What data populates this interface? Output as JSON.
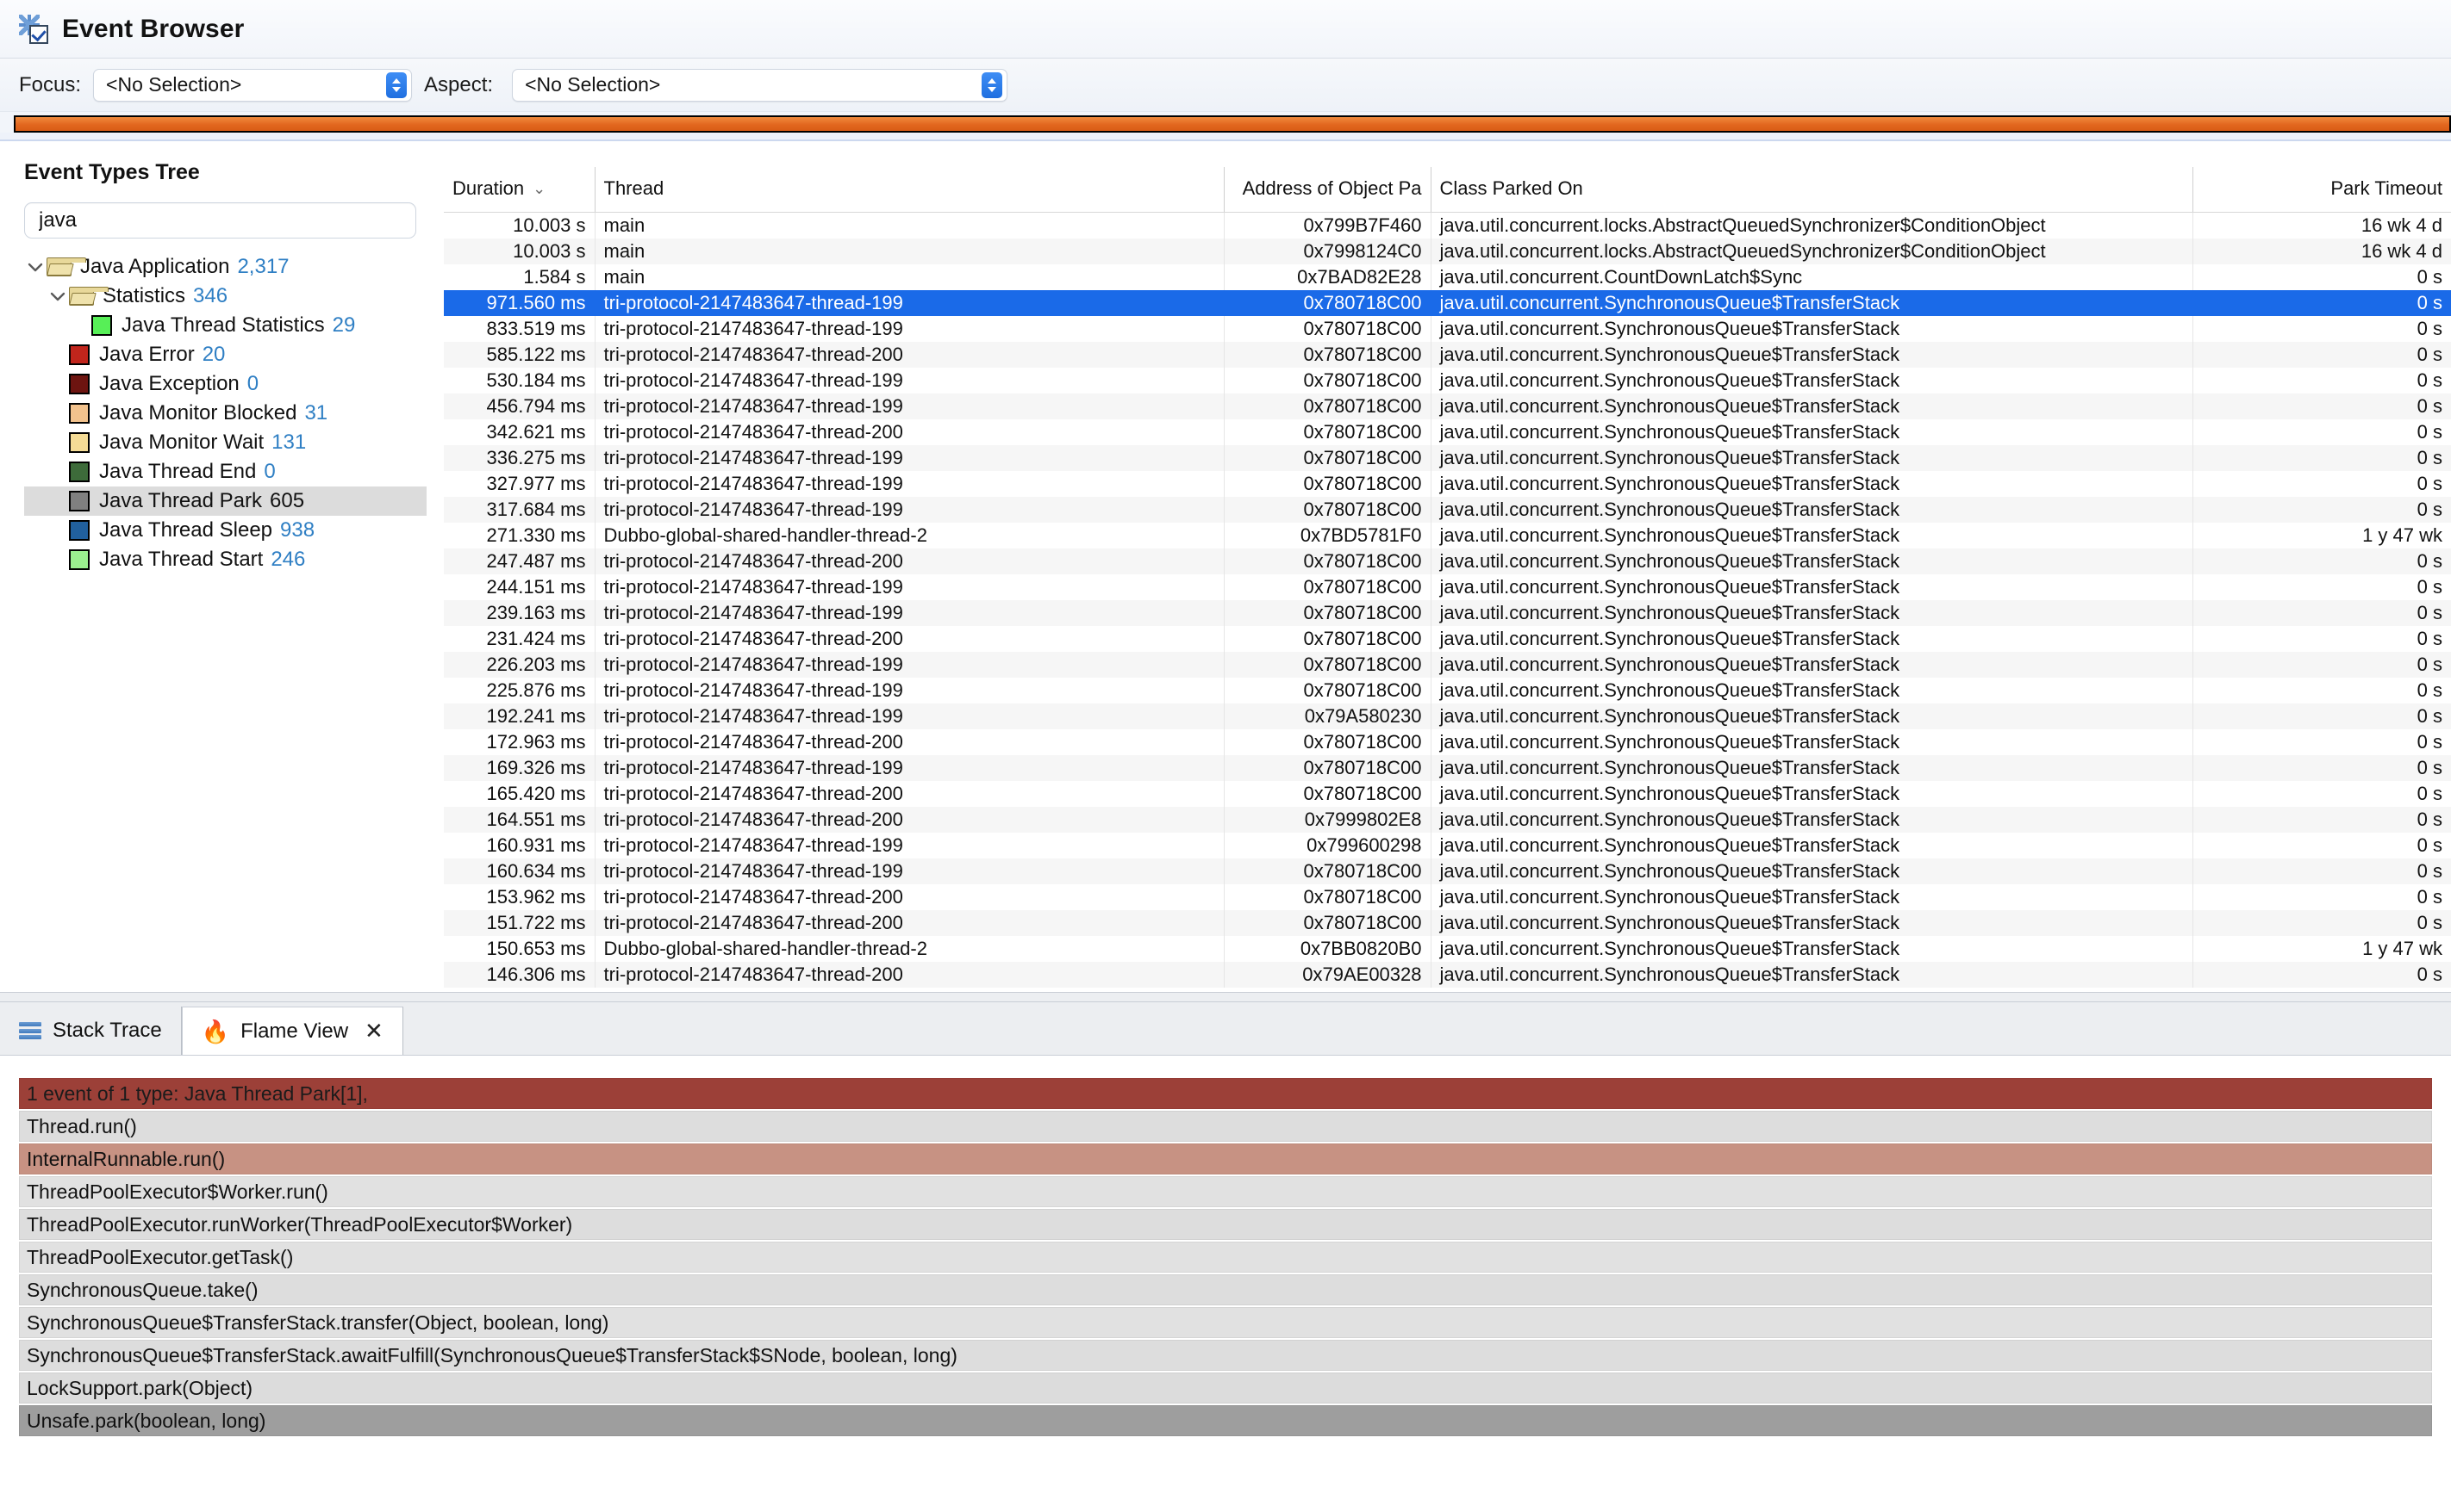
{
  "window": {
    "title": "Event Browser",
    "icon": "event-browser-icon"
  },
  "toolbar": {
    "focus_label": "Focus:",
    "focus_value": "<No Selection>",
    "aspect_label": "Aspect:",
    "aspect_value": "<No Selection>",
    "ruler_color": "#e2671f"
  },
  "tree": {
    "title": "Event Types Tree",
    "filter_value": "java",
    "filter_placeholder": "",
    "items": [
      {
        "label": "Java Application",
        "count": "2,317",
        "indent": 0,
        "kind": "folder",
        "expanded": true,
        "selected": false
      },
      {
        "label": "Statistics",
        "count": "346",
        "indent": 1,
        "kind": "folder",
        "expanded": true,
        "selected": false
      },
      {
        "label": "Java Thread Statistics",
        "count": "29",
        "indent": 3,
        "kind": "swatch",
        "color": "#57ef57",
        "selected": false
      },
      {
        "label": "Java Error",
        "count": "20",
        "indent": 2,
        "kind": "swatch",
        "color": "#c0251c",
        "selected": false
      },
      {
        "label": "Java Exception",
        "count": "0",
        "indent": 2,
        "kind": "swatch",
        "color": "#6d1410",
        "selected": false
      },
      {
        "label": "Java Monitor Blocked",
        "count": "31",
        "indent": 2,
        "kind": "swatch",
        "color": "#f2c28d",
        "selected": false
      },
      {
        "label": "Java Monitor Wait",
        "count": "131",
        "indent": 2,
        "kind": "swatch",
        "color": "#f5dc96",
        "selected": false
      },
      {
        "label": "Java Thread End",
        "count": "0",
        "indent": 2,
        "kind": "swatch",
        "color": "#3d6b3a",
        "selected": false
      },
      {
        "label": "Java Thread Park",
        "count": "605",
        "indent": 2,
        "kind": "swatch",
        "color": "#808080",
        "selected": true
      },
      {
        "label": "Java Thread Sleep",
        "count": "938",
        "indent": 2,
        "kind": "swatch",
        "color": "#21609e",
        "selected": false
      },
      {
        "label": "Java Thread Start",
        "count": "246",
        "indent": 2,
        "kind": "swatch",
        "color": "#9bef8f",
        "selected": false
      }
    ]
  },
  "table": {
    "columns": [
      {
        "key": "duration",
        "label": "Duration",
        "align": "right",
        "sorted": true,
        "sort_glyph": "⌄"
      },
      {
        "key": "thread",
        "label": "Thread",
        "align": "left"
      },
      {
        "key": "address",
        "label": "Address of Object Pa",
        "align": "right"
      },
      {
        "key": "class",
        "label": "Class Parked On",
        "align": "left"
      },
      {
        "key": "timeout",
        "label": "Park Timeout",
        "align": "right"
      }
    ],
    "selected_row_index": 3,
    "rows": [
      {
        "duration": "10.003 s",
        "thread": "main",
        "address": "0x799B7F460",
        "class": "java.util.concurrent.locks.AbstractQueuedSynchronizer$ConditionObject",
        "timeout": "16 wk 4 d"
      },
      {
        "duration": "10.003 s",
        "thread": "main",
        "address": "0x7998124C0",
        "class": "java.util.concurrent.locks.AbstractQueuedSynchronizer$ConditionObject",
        "timeout": "16 wk 4 d"
      },
      {
        "duration": "1.584 s",
        "thread": "main",
        "address": "0x7BAD82E28",
        "class": "java.util.concurrent.CountDownLatch$Sync",
        "timeout": "0 s"
      },
      {
        "duration": "971.560 ms",
        "thread": "tri-protocol-2147483647-thread-199",
        "address": "0x780718C00",
        "class": "java.util.concurrent.SynchronousQueue$TransferStack",
        "timeout": "0 s"
      },
      {
        "duration": "833.519 ms",
        "thread": "tri-protocol-2147483647-thread-199",
        "address": "0x780718C00",
        "class": "java.util.concurrent.SynchronousQueue$TransferStack",
        "timeout": "0 s"
      },
      {
        "duration": "585.122 ms",
        "thread": "tri-protocol-2147483647-thread-200",
        "address": "0x780718C00",
        "class": "java.util.concurrent.SynchronousQueue$TransferStack",
        "timeout": "0 s"
      },
      {
        "duration": "530.184 ms",
        "thread": "tri-protocol-2147483647-thread-199",
        "address": "0x780718C00",
        "class": "java.util.concurrent.SynchronousQueue$TransferStack",
        "timeout": "0 s"
      },
      {
        "duration": "456.794 ms",
        "thread": "tri-protocol-2147483647-thread-199",
        "address": "0x780718C00",
        "class": "java.util.concurrent.SynchronousQueue$TransferStack",
        "timeout": "0 s"
      },
      {
        "duration": "342.621 ms",
        "thread": "tri-protocol-2147483647-thread-200",
        "address": "0x780718C00",
        "class": "java.util.concurrent.SynchronousQueue$TransferStack",
        "timeout": "0 s"
      },
      {
        "duration": "336.275 ms",
        "thread": "tri-protocol-2147483647-thread-199",
        "address": "0x780718C00",
        "class": "java.util.concurrent.SynchronousQueue$TransferStack",
        "timeout": "0 s"
      },
      {
        "duration": "327.977 ms",
        "thread": "tri-protocol-2147483647-thread-199",
        "address": "0x780718C00",
        "class": "java.util.concurrent.SynchronousQueue$TransferStack",
        "timeout": "0 s"
      },
      {
        "duration": "317.684 ms",
        "thread": "tri-protocol-2147483647-thread-199",
        "address": "0x780718C00",
        "class": "java.util.concurrent.SynchronousQueue$TransferStack",
        "timeout": "0 s"
      },
      {
        "duration": "271.330 ms",
        "thread": "Dubbo-global-shared-handler-thread-2",
        "address": "0x7BD5781F0",
        "class": "java.util.concurrent.SynchronousQueue$TransferStack",
        "timeout": "1 y 47 wk"
      },
      {
        "duration": "247.487 ms",
        "thread": "tri-protocol-2147483647-thread-200",
        "address": "0x780718C00",
        "class": "java.util.concurrent.SynchronousQueue$TransferStack",
        "timeout": "0 s"
      },
      {
        "duration": "244.151 ms",
        "thread": "tri-protocol-2147483647-thread-199",
        "address": "0x780718C00",
        "class": "java.util.concurrent.SynchronousQueue$TransferStack",
        "timeout": "0 s"
      },
      {
        "duration": "239.163 ms",
        "thread": "tri-protocol-2147483647-thread-199",
        "address": "0x780718C00",
        "class": "java.util.concurrent.SynchronousQueue$TransferStack",
        "timeout": "0 s"
      },
      {
        "duration": "231.424 ms",
        "thread": "tri-protocol-2147483647-thread-200",
        "address": "0x780718C00",
        "class": "java.util.concurrent.SynchronousQueue$TransferStack",
        "timeout": "0 s"
      },
      {
        "duration": "226.203 ms",
        "thread": "tri-protocol-2147483647-thread-199",
        "address": "0x780718C00",
        "class": "java.util.concurrent.SynchronousQueue$TransferStack",
        "timeout": "0 s"
      },
      {
        "duration": "225.876 ms",
        "thread": "tri-protocol-2147483647-thread-199",
        "address": "0x780718C00",
        "class": "java.util.concurrent.SynchronousQueue$TransferStack",
        "timeout": "0 s"
      },
      {
        "duration": "192.241 ms",
        "thread": "tri-protocol-2147483647-thread-199",
        "address": "0x79A580230",
        "class": "java.util.concurrent.SynchronousQueue$TransferStack",
        "timeout": "0 s"
      },
      {
        "duration": "172.963 ms",
        "thread": "tri-protocol-2147483647-thread-200",
        "address": "0x780718C00",
        "class": "java.util.concurrent.SynchronousQueue$TransferStack",
        "timeout": "0 s"
      },
      {
        "duration": "169.326 ms",
        "thread": "tri-protocol-2147483647-thread-199",
        "address": "0x780718C00",
        "class": "java.util.concurrent.SynchronousQueue$TransferStack",
        "timeout": "0 s"
      },
      {
        "duration": "165.420 ms",
        "thread": "tri-protocol-2147483647-thread-200",
        "address": "0x780718C00",
        "class": "java.util.concurrent.SynchronousQueue$TransferStack",
        "timeout": "0 s"
      },
      {
        "duration": "164.551 ms",
        "thread": "tri-protocol-2147483647-thread-200",
        "address": "0x7999802E8",
        "class": "java.util.concurrent.SynchronousQueue$TransferStack",
        "timeout": "0 s"
      },
      {
        "duration": "160.931 ms",
        "thread": "tri-protocol-2147483647-thread-199",
        "address": "0x799600298",
        "class": "java.util.concurrent.SynchronousQueue$TransferStack",
        "timeout": "0 s"
      },
      {
        "duration": "160.634 ms",
        "thread": "tri-protocol-2147483647-thread-199",
        "address": "0x780718C00",
        "class": "java.util.concurrent.SynchronousQueue$TransferStack",
        "timeout": "0 s"
      },
      {
        "duration": "153.962 ms",
        "thread": "tri-protocol-2147483647-thread-200",
        "address": "0x780718C00",
        "class": "java.util.concurrent.SynchronousQueue$TransferStack",
        "timeout": "0 s"
      },
      {
        "duration": "151.722 ms",
        "thread": "tri-protocol-2147483647-thread-200",
        "address": "0x780718C00",
        "class": "java.util.concurrent.SynchronousQueue$TransferStack",
        "timeout": "0 s"
      },
      {
        "duration": "150.653 ms",
        "thread": "Dubbo-global-shared-handler-thread-2",
        "address": "0x7BB0820B0",
        "class": "java.util.concurrent.SynchronousQueue$TransferStack",
        "timeout": "1 y 47 wk"
      },
      {
        "duration": "146.306 ms",
        "thread": "tri-protocol-2147483647-thread-200",
        "address": "0x79AE00328",
        "class": "java.util.concurrent.SynchronousQueue$TransferStack",
        "timeout": "0 s"
      }
    ]
  },
  "bottom": {
    "tabs": [
      {
        "label": "Stack Trace",
        "icon": "list-lines-icon",
        "active": false,
        "closable": false
      },
      {
        "label": "Flame View",
        "icon": "flame-icon",
        "active": true,
        "closable": true,
        "close_glyph": "✕"
      }
    ],
    "flame": {
      "frames": [
        {
          "label": "1 event of 1 type: Java Thread Park[1],",
          "width_pct": 100,
          "color": "#9c4038",
          "text_color": "#1b1b1b"
        },
        {
          "label": "Thread.run()",
          "width_pct": 100,
          "color": "#dddddd",
          "text_color": "#111111"
        },
        {
          "label": "InternalRunnable.run()",
          "width_pct": 100,
          "color": "#c79283",
          "text_color": "#111111"
        },
        {
          "label": "ThreadPoolExecutor$Worker.run()",
          "width_pct": 100,
          "color": "#e1e1e1",
          "text_color": "#111111"
        },
        {
          "label": "ThreadPoolExecutor.runWorker(ThreadPoolExecutor$Worker)",
          "width_pct": 100,
          "color": "#dddddd",
          "text_color": "#111111"
        },
        {
          "label": "ThreadPoolExecutor.getTask()",
          "width_pct": 100,
          "color": "#e1e1e1",
          "text_color": "#111111"
        },
        {
          "label": "SynchronousQueue.take()",
          "width_pct": 100,
          "color": "#dddddd",
          "text_color": "#111111"
        },
        {
          "label": "SynchronousQueue$TransferStack.transfer(Object, boolean, long)",
          "width_pct": 100,
          "color": "#e1e1e1",
          "text_color": "#111111"
        },
        {
          "label": "SynchronousQueue$TransferStack.awaitFulfill(SynchronousQueue$TransferStack$SNode, boolean, long)",
          "width_pct": 100,
          "color": "#dddddd",
          "text_color": "#111111"
        },
        {
          "label": "LockSupport.park(Object)",
          "width_pct": 100,
          "color": "#dcdcdc",
          "text_color": "#111111"
        },
        {
          "label": "Unsafe.park(boolean, long)",
          "width_pct": 100,
          "color": "#9e9e9e",
          "text_color": "#111111"
        }
      ]
    }
  }
}
